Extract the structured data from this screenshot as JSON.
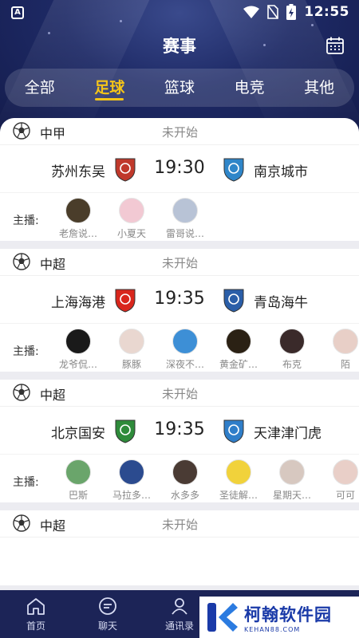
{
  "status_bar": {
    "time": "12:55"
  },
  "header": {
    "title": "赛事"
  },
  "tabs": [
    {
      "label": "全部",
      "active": false
    },
    {
      "label": "足球",
      "active": true
    },
    {
      "label": "篮球",
      "active": false
    },
    {
      "label": "电竞",
      "active": false
    },
    {
      "label": "其他",
      "active": false
    }
  ],
  "hosts_label": "主播:",
  "matches": [
    {
      "league": "中甲",
      "state": "未开始",
      "home": "苏州东吴",
      "time": "19:30",
      "away": "南京城市",
      "home_color": "#c0392b",
      "away_color": "#2f86c9",
      "hosts": [
        {
          "name": "老詹说…",
          "color": "#4a3d2a"
        },
        {
          "name": "小夏天",
          "color": "#f2c9d3"
        },
        {
          "name": "雷哥说…",
          "color": "#b8c3d6"
        }
      ]
    },
    {
      "league": "中超",
      "state": "未开始",
      "home": "上海海港",
      "time": "19:35",
      "away": "青岛海牛",
      "home_color": "#d9261c",
      "away_color": "#2a5ea8",
      "hosts": [
        {
          "name": "龙爷侃…",
          "color": "#1a1a1a"
        },
        {
          "name": "豚豚",
          "color": "#e9d7d0"
        },
        {
          "name": "深夜不…",
          "color": "#3d8fd6"
        },
        {
          "name": "黄金矿…",
          "color": "#2b2114"
        },
        {
          "name": "布克",
          "color": "#3a2a2a"
        },
        {
          "name": "陌",
          "color": "#e8cfc7"
        }
      ]
    },
    {
      "league": "中超",
      "state": "未开始",
      "home": "北京国安",
      "time": "19:35",
      "away": "天津津门虎",
      "home_color": "#2e8b3a",
      "away_color": "#2f7ec9",
      "hosts": [
        {
          "name": "巴斯",
          "color": "#6aa56b"
        },
        {
          "name": "马拉多…",
          "color": "#2b4b8f"
        },
        {
          "name": "水多多",
          "color": "#4a3b34"
        },
        {
          "name": "圣徒解…",
          "color": "#f1d23b"
        },
        {
          "name": "星期天…",
          "color": "#d7c8c0"
        },
        {
          "name": "可可",
          "color": "#e9cfc8"
        }
      ]
    },
    {
      "league": "中超",
      "state": "未开始"
    }
  ],
  "bottom_nav": [
    {
      "label": "首页",
      "icon": "home-icon"
    },
    {
      "label": "聊天",
      "icon": "chat-icon"
    },
    {
      "label": "通讯录",
      "icon": "contacts-icon"
    }
  ],
  "watermark": {
    "title": "柯翰软件园",
    "subtitle": "KEHAN88.COM"
  }
}
